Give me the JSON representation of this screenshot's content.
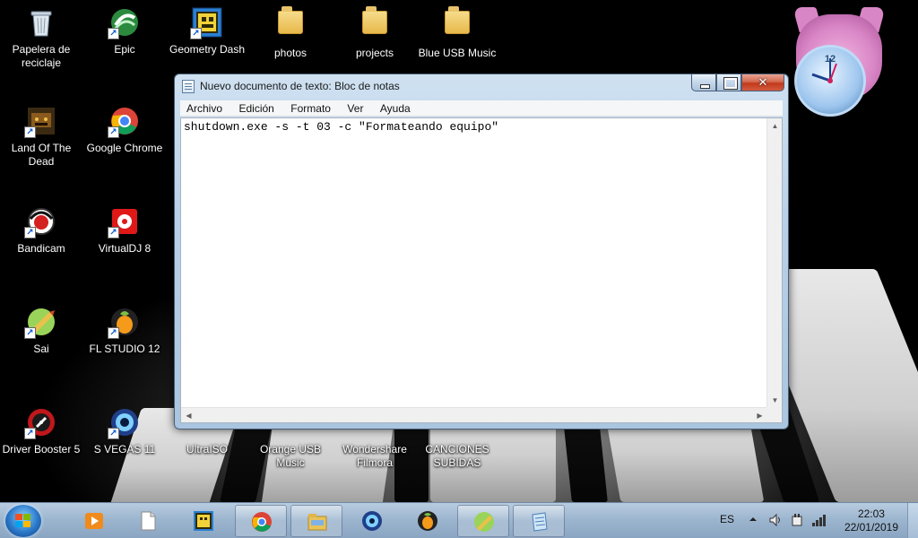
{
  "desktop": {
    "icons": [
      {
        "label": "Papelera de reciclaje",
        "icon": "recycle-bin-icon"
      },
      {
        "label": "Epic",
        "icon": "epic-icon"
      },
      {
        "label": "Geometry Dash",
        "icon": "geometry-dash-icon"
      },
      {
        "label": "photos",
        "icon": "folder-icon"
      },
      {
        "label": "projects",
        "icon": "folder-icon"
      },
      {
        "label": "Blue USB Music",
        "icon": "folder-icon"
      },
      {
        "label": "Land Of The Dead",
        "icon": "land-of-the-dead-icon"
      },
      {
        "label": "Google Chrome",
        "icon": "chrome-icon"
      },
      {
        "label": "Bandicam",
        "icon": "bandicam-icon"
      },
      {
        "label": "VirtualDJ 8",
        "icon": "virtualdj-icon"
      },
      {
        "label": "Sai",
        "icon": "sai-icon"
      },
      {
        "label": "FL STUDIO 12",
        "icon": "fl-studio-icon"
      },
      {
        "label": "Driver Booster 5",
        "icon": "driver-booster-icon"
      },
      {
        "label": "S VEGAS 11",
        "icon": "vegas-icon"
      },
      {
        "label": "UltraISO",
        "icon": "ultraiso-icon"
      },
      {
        "label": "Orange USB Music",
        "icon": "folder-icon"
      },
      {
        "label": "Wondershare Filmora",
        "icon": "filmora-icon"
      },
      {
        "label": "CANCIONES SUBIDAS",
        "icon": "folder-icon"
      }
    ]
  },
  "notepad": {
    "title": "Nuevo documento de texto: Bloc de notas",
    "menu": [
      "Archivo",
      "Edición",
      "Formato",
      "Ver",
      "Ayuda"
    ],
    "content": "shutdown.exe -s -t 03 -c \"Formateando equipo\""
  },
  "taskbar": {
    "apps": [
      {
        "icon": "media-player-icon",
        "open": false
      },
      {
        "icon": "document-icon",
        "open": false
      },
      {
        "icon": "geometry-dash-icon",
        "open": false
      },
      {
        "icon": "chrome-icon",
        "open": true
      },
      {
        "icon": "file-explorer-icon",
        "open": true
      },
      {
        "icon": "vegas-icon",
        "open": false
      },
      {
        "icon": "fl-studio-icon",
        "open": false
      },
      {
        "icon": "sai-icon",
        "open": true
      },
      {
        "icon": "notepad-icon",
        "open": true
      }
    ],
    "tray": {
      "lang": "ES",
      "time": "22:03",
      "date": "22/01/2019"
    }
  },
  "colors": {
    "taskbar": "#9db6cf",
    "window_frame": "#b9d1e8",
    "close_button": "#c2391b"
  }
}
